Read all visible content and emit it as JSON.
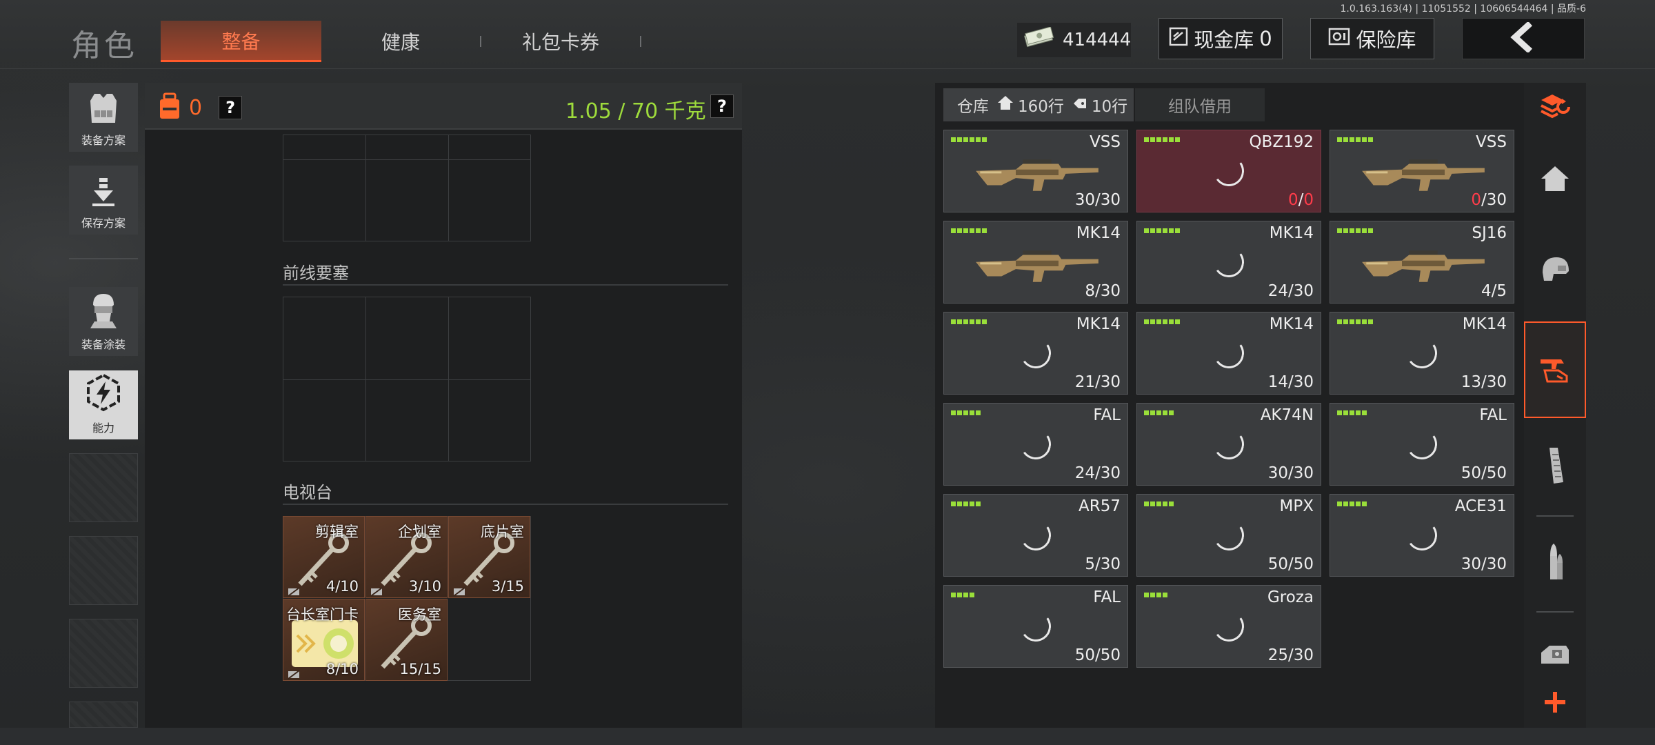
{
  "version": "1.0.163.163(4) | 11051552 | 10606544464 | 品质-6",
  "header": {
    "title": "角色",
    "tabs": [
      {
        "label": "整备",
        "active": true
      },
      {
        "label": "健康",
        "active": false
      },
      {
        "label": "礼包卡券",
        "active": false
      }
    ],
    "money": "414444",
    "cash_vault_label": "现金库",
    "cash_vault_count": "0",
    "safe_label": "保险库"
  },
  "left_sidebar": {
    "items": [
      {
        "label": "装备方案",
        "icon": "vest-icon"
      },
      {
        "label": "保存方案",
        "icon": "download-icon"
      },
      {
        "label": "装备涂装",
        "icon": "soldier-icon"
      },
      {
        "label": "能力",
        "icon": "lightning-hex-icon",
        "active": true
      }
    ]
  },
  "loadout": {
    "backpack_count": "0",
    "help1": "?",
    "weight": "1.05 / 70 千克",
    "help2": "?",
    "sections": [
      {
        "label": "前线要塞"
      },
      {
        "label": "电视台"
      }
    ],
    "keys": [
      {
        "name": "剪辑室",
        "count": "4/10"
      },
      {
        "name": "企划室",
        "count": "3/10"
      },
      {
        "name": "底片室",
        "count": "3/15"
      },
      {
        "name": "台长室门卡",
        "count": "8/10",
        "type": "card"
      },
      {
        "name": "医务室",
        "count": "15/15"
      }
    ]
  },
  "warehouse": {
    "tab_label": "仓库",
    "rows": "160行",
    "key_rows": "10行",
    "team_tab": "组队借用",
    "items": [
      {
        "name": "VSS",
        "ammo": "30/30",
        "stars": 6,
        "image": "gun-icon"
      },
      {
        "name": "QBZ192",
        "ammo_cur": "0",
        "ammo_max": "0",
        "stars": 6,
        "highlight": "red"
      },
      {
        "name": "VSS",
        "ammo_cur": "0",
        "ammo_max": "30",
        "stars": 6,
        "image": "gun-icon"
      },
      {
        "name": "MK14",
        "ammo": "8/30",
        "stars": 6,
        "image": "gun-icon"
      },
      {
        "name": "MK14",
        "ammo": "24/30",
        "stars": 6
      },
      {
        "name": "SJ16",
        "ammo": "4/5",
        "stars": 6,
        "image": "gun-icon"
      },
      {
        "name": "MK14",
        "ammo": "21/30",
        "stars": 6
      },
      {
        "name": "MK14",
        "ammo": "14/30",
        "stars": 6
      },
      {
        "name": "MK14",
        "ammo": "13/30",
        "stars": 6
      },
      {
        "name": "FAL",
        "ammo": "24/30",
        "stars": 5
      },
      {
        "name": "AK74N",
        "ammo": "30/30",
        "stars": 5
      },
      {
        "name": "FAL",
        "ammo": "50/50",
        "stars": 5
      },
      {
        "name": "AR57",
        "ammo": "5/30",
        "stars": 5
      },
      {
        "name": "MPX",
        "ammo": "50/50",
        "stars": 5
      },
      {
        "name": "ACE31",
        "ammo": "30/30",
        "stars": 5
      },
      {
        "name": "FAL",
        "ammo": "50/50",
        "stars": 4
      },
      {
        "name": "Groza",
        "ammo": "25/30",
        "stars": 4
      }
    ]
  },
  "right_sidebar": {
    "icons": [
      "layers-refresh-icon",
      "home-icon",
      "helmet-icon",
      "weapon-hand-icon",
      "magazine-icon",
      "ammo-icon",
      "scope-icon",
      "add-icon"
    ]
  },
  "colors": {
    "accent": "#ff5a2b",
    "weight": "#9edb3c",
    "stars": "#9adf3a",
    "alert": "#ff3c4a"
  }
}
